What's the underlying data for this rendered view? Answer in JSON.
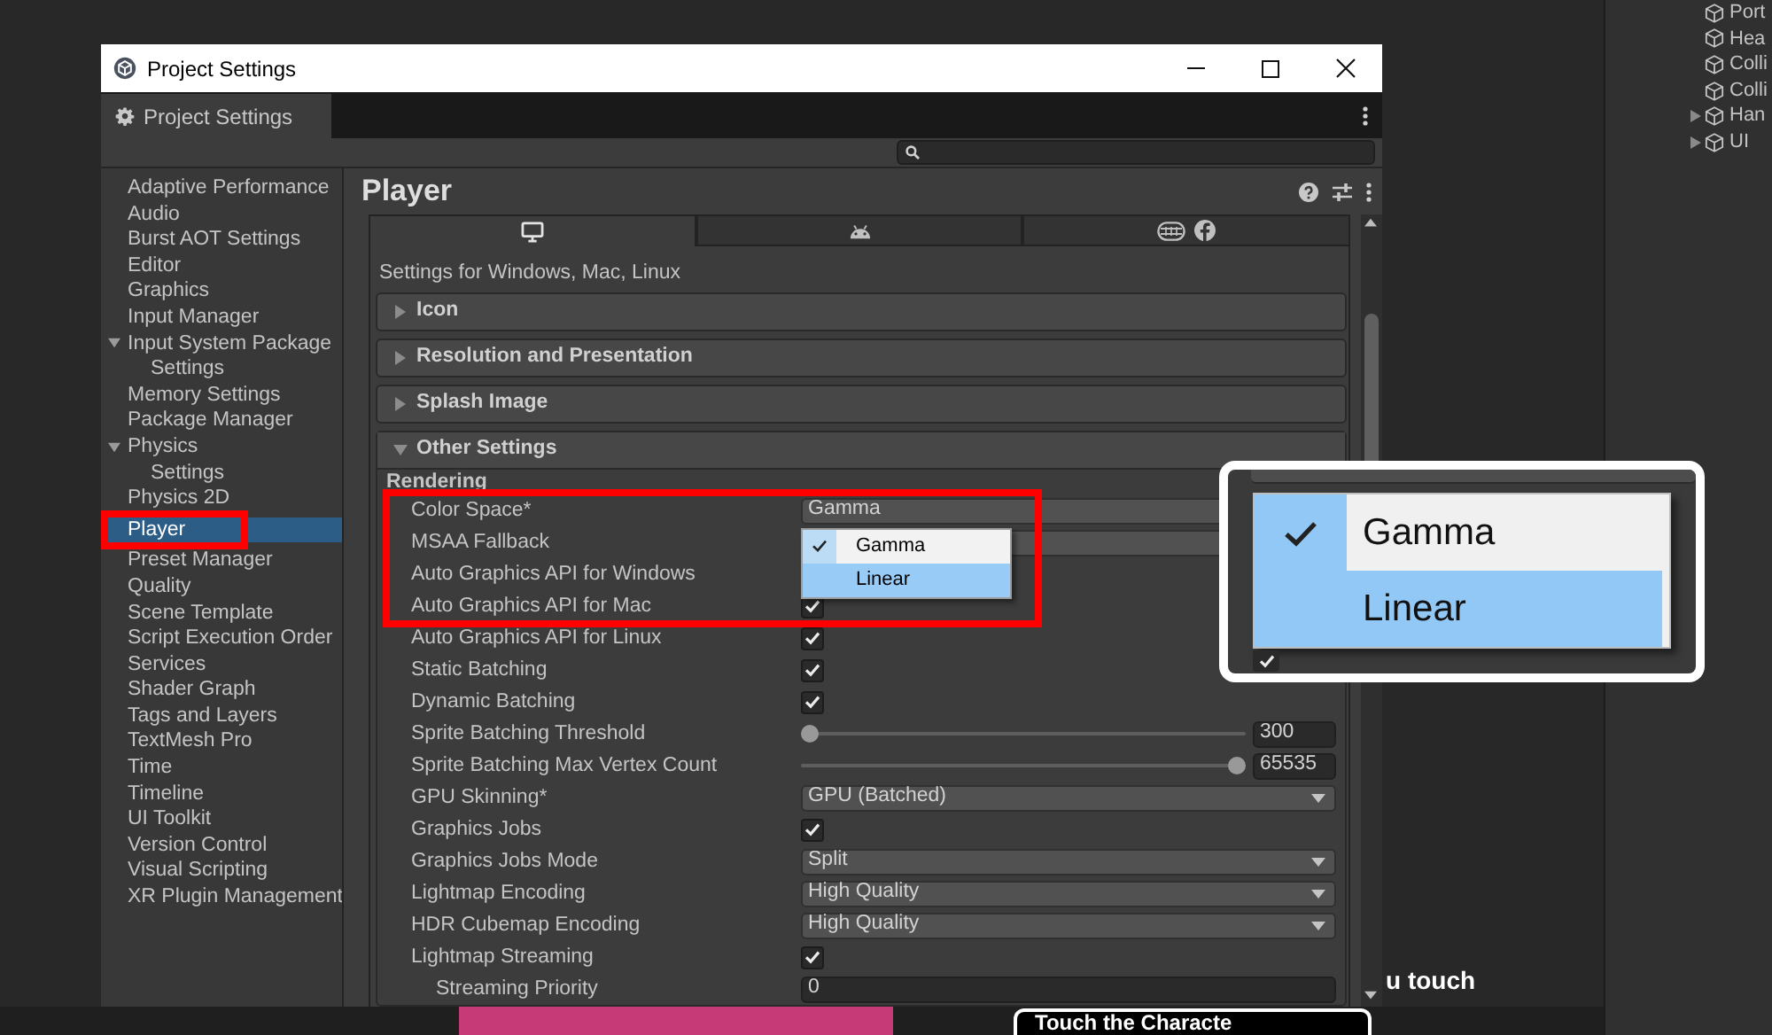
{
  "window": {
    "title": "Project Settings",
    "tab": "Project Settings"
  },
  "sidebar": {
    "items": [
      {
        "label": "Adaptive Performance",
        "selected": false,
        "highlighted": false
      },
      {
        "label": "Audio",
        "selected": false,
        "highlighted": false
      },
      {
        "label": "Burst AOT Settings",
        "selected": false,
        "highlighted": false
      },
      {
        "label": "Editor",
        "selected": false,
        "highlighted": false
      },
      {
        "label": "Graphics",
        "selected": false,
        "highlighted": false
      },
      {
        "label": "Input Manager",
        "selected": false,
        "highlighted": false
      },
      {
        "label": "Input System Package",
        "selected": false,
        "highlighted": false,
        "expanded": true,
        "children": [
          {
            "label": "Settings",
            "selected": false,
            "highlighted": false
          }
        ]
      },
      {
        "label": "Memory Settings",
        "selected": false,
        "highlighted": false
      },
      {
        "label": "Package Manager",
        "selected": false,
        "highlighted": false
      },
      {
        "label": "Physics",
        "selected": false,
        "highlighted": false,
        "expanded": true,
        "children": [
          {
            "label": "Settings",
            "selected": false,
            "highlighted": false
          }
        ]
      },
      {
        "label": "Physics 2D",
        "selected": false,
        "highlighted": false
      },
      {
        "label": "Player",
        "selected": true,
        "highlighted": true
      },
      {
        "label": "Preset Manager",
        "selected": false,
        "highlighted": false
      },
      {
        "label": "Quality",
        "selected": false,
        "highlighted": false
      },
      {
        "label": "Scene Template",
        "selected": false,
        "highlighted": false
      },
      {
        "label": "Script Execution Order",
        "selected": false,
        "highlighted": false
      },
      {
        "label": "Services",
        "selected": false,
        "highlighted": false
      },
      {
        "label": "Shader Graph",
        "selected": false,
        "highlighted": false
      },
      {
        "label": "Tags and Layers",
        "selected": false,
        "highlighted": false
      },
      {
        "label": "TextMesh Pro",
        "selected": false,
        "highlighted": false
      },
      {
        "label": "Time",
        "selected": false,
        "highlighted": false
      },
      {
        "label": "Timeline",
        "selected": false,
        "highlighted": false
      },
      {
        "label": "UI Toolkit",
        "selected": false,
        "highlighted": false
      },
      {
        "label": "Version Control",
        "selected": false,
        "highlighted": false
      },
      {
        "label": "Visual Scripting",
        "selected": false,
        "highlighted": false
      },
      {
        "label": "XR Plugin Management",
        "selected": false,
        "highlighted": false
      }
    ]
  },
  "inspector": {
    "title": "Player",
    "platform_tabs": [
      {
        "selected": true
      },
      {
        "selected": false
      },
      {
        "selected": false
      }
    ],
    "caption": "Settings for Windows, Mac, Linux",
    "sections": [
      {
        "label": "Icon",
        "expanded": false
      },
      {
        "label": "Resolution and Presentation",
        "expanded": false
      },
      {
        "label": "Splash Image",
        "expanded": false
      },
      {
        "label": "Other Settings",
        "expanded": true,
        "group": "Rendering",
        "properties": [
          {
            "label": "Color Space*",
            "kind": "dropdown",
            "value": "Gamma",
            "highlighted": true,
            "menu": [
              {
                "label": "Gamma",
                "selected": true,
                "hovered": false
              },
              {
                "label": "Linear",
                "selected": false,
                "hovered": true
              }
            ]
          },
          {
            "label": "MSAA Fallback",
            "kind": "dropdown",
            "highlighted": true
          },
          {
            "label": "Auto Graphics API for Windows",
            "kind": "covered",
            "highlighted": true
          },
          {
            "label": "Auto Graphics API for Mac",
            "kind": "checkbox",
            "checked": true,
            "highlighted": true
          },
          {
            "label": "Auto Graphics API for Linux",
            "kind": "checkbox",
            "checked": true,
            "highlighted": false
          },
          {
            "label": "Static Batching",
            "kind": "checkbox",
            "checked": true,
            "highlighted": false
          },
          {
            "label": "Dynamic Batching",
            "kind": "checkbox",
            "checked": true,
            "highlighted": false
          },
          {
            "label": "Sprite Batching Threshold",
            "kind": "slider",
            "level": 0,
            "value": "300",
            "highlighted": false
          },
          {
            "label": "Sprite Batching Max Vertex Count",
            "kind": "slider",
            "level": 1,
            "value": "65535",
            "highlighted": false
          },
          {
            "label": "GPU Skinning*",
            "kind": "dropdown",
            "value": "GPU (Batched)",
            "highlighted": false
          },
          {
            "label": "Graphics Jobs",
            "kind": "checkbox",
            "checked": true,
            "highlighted": false
          },
          {
            "label": "Graphics Jobs Mode",
            "kind": "dropdown",
            "value": "Split",
            "highlighted": false
          },
          {
            "label": "Lightmap Encoding",
            "kind": "dropdown",
            "value": "High Quality",
            "highlighted": false
          },
          {
            "label": "HDR Cubemap Encoding",
            "kind": "dropdown",
            "value": "High Quality",
            "highlighted": false
          },
          {
            "label": "Lightmap Streaming",
            "kind": "checkbox",
            "checked": true,
            "highlighted": false,
            "children": [
              {
                "label": "Streaming Priority",
                "kind": "number",
                "value": "0",
                "highlighted": false
              }
            ]
          }
        ]
      }
    ]
  },
  "callout": {
    "menu": [
      {
        "label": "Gamma",
        "selected": true,
        "hovered": false
      },
      {
        "label": "Linear",
        "selected": false,
        "hovered": true
      }
    ],
    "checkbox": {
      "checked": true
    }
  },
  "hierarchy": {
    "items": [
      {
        "label": "Port",
        "kind": "object"
      },
      {
        "label": "Hea",
        "kind": "object"
      },
      {
        "label": "Colli",
        "kind": "object"
      },
      {
        "label": "Colli",
        "kind": "object"
      },
      {
        "label": "Han",
        "kind": "group",
        "expanded": false
      },
      {
        "label": "UI",
        "kind": "group",
        "expanded": false
      }
    ]
  },
  "game_view": {
    "caption": "u touch",
    "prompt": "Touch the Characte"
  }
}
